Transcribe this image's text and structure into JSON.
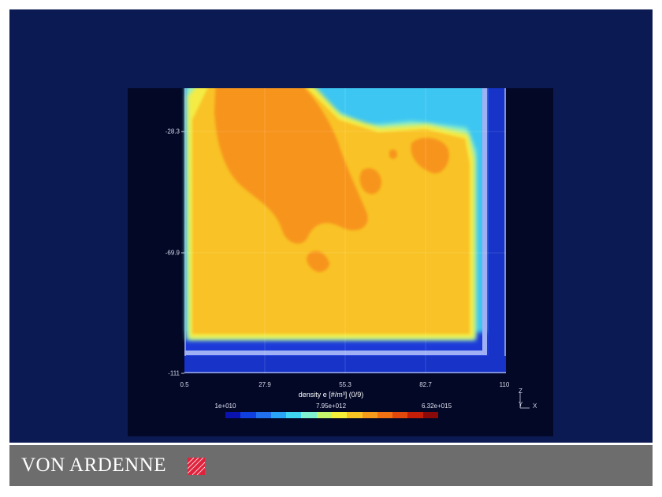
{
  "plot": {
    "x_ticks": [
      "0.5",
      "27.9",
      "55.3",
      "82.7",
      "110"
    ],
    "y_ticks": [
      "-28.3",
      "-69.9",
      "-111"
    ],
    "colorbar_title": "density e [#/m³] (0/9)",
    "colorbar_ticks": [
      "1e+010",
      "7.95e+012",
      "6.32e+015"
    ],
    "colorbar_colors": [
      "#0a12b0",
      "#1040e0",
      "#2070f0",
      "#2aa4f4",
      "#3fd4f0",
      "#7ff0d0",
      "#c6f46a",
      "#f4f03a",
      "#f8c424",
      "#f59a1a",
      "#f07012",
      "#e0480c",
      "#c41e08",
      "#8a0a0a"
    ],
    "axis_icon": {
      "z": "Z",
      "y": "Y",
      "x": "X"
    }
  },
  "footer": {
    "logo_text": "VON ARDENNE",
    "logo_color": "#e0223c"
  }
}
